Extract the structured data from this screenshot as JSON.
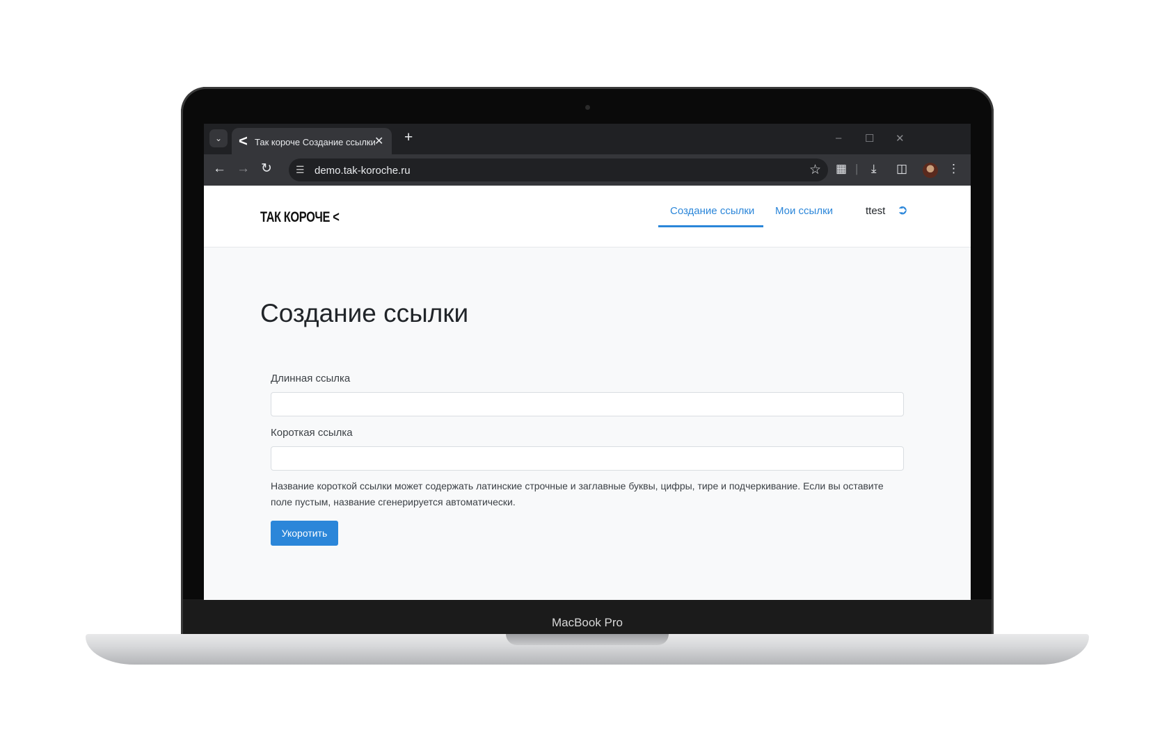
{
  "device": {
    "model_label": "MacBook Pro"
  },
  "browser": {
    "tab": {
      "title": "Так короче Создание ссылки",
      "favicon": "<"
    },
    "new_tab": "+",
    "url": "demo.tak-koroche.ru",
    "icons": {
      "tab_search": "chevron-down-icon",
      "back": "arrow-left-icon",
      "forward": "arrow-right-icon",
      "reload": "reload-icon",
      "site_info": "tune-icon",
      "bookmark": "star-icon",
      "extensions": "puzzle-icon",
      "downloads": "download-icon",
      "side_panel": "side-panel-icon",
      "menu": "kebab-icon"
    }
  },
  "header": {
    "logo": "ТАК КОРОЧЕ <",
    "nav": [
      {
        "label": "Создание ссылки",
        "active": true
      },
      {
        "label": "Мои ссылки",
        "active": false
      }
    ],
    "username": "ttest"
  },
  "main": {
    "title": "Создание ссылки",
    "long_link_label": "Длинная ссылка",
    "long_link_value": "",
    "short_link_label": "Короткая ссылка",
    "short_link_value": "",
    "help_text": "Название короткой ссылки может содержать латинские строчные и заглавные буквы, цифры, тире и подчеркивание. Если вы оставите поле пустым, название сгенерируется автоматически.",
    "submit_label": "Укоротить"
  },
  "colors": {
    "accent": "#2b86d9",
    "page_bg": "#f8f9fa",
    "browser_dark": "#202124",
    "toolbar": "#35363a"
  }
}
